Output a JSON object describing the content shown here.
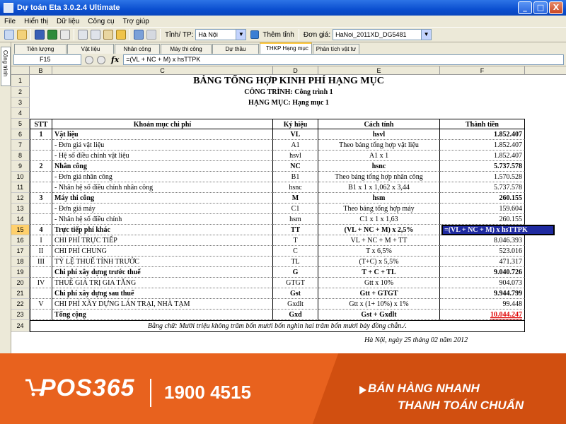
{
  "window": {
    "title": "Dự toán Eta 3.0.2.4 Ultimate",
    "min": "_",
    "max": "□",
    "close": "X"
  },
  "menu": [
    "File",
    "Hiển thị",
    "Dữ liệu",
    "Công cụ",
    "Trợ giúp"
  ],
  "toolbar": {
    "province_label": "Tỉnh/ TP:",
    "province_value": "Hà Nội",
    "add_province": "Thêm tỉnh",
    "price_label": "Đơn giá:",
    "price_value": "HaNoi_2011XD_DG5481"
  },
  "left_tab": "Công trình",
  "tabs": [
    "Tiên lượng",
    "Vật liệu",
    "Nhân công",
    "Máy thi công",
    "Dự thầu",
    "THKP Hạng mục",
    "Phân tích vật tư"
  ],
  "active_tab": "THKP Hạng mục",
  "formula_bar": {
    "cell_ref": "F15",
    "fx": "fx",
    "formula": "=(VL + NC + M) x hsTTPK"
  },
  "columns": [
    "B",
    "C",
    "D",
    "E",
    "F"
  ],
  "sheet": {
    "title": "BẢNG TỔNG HỢP KINH PHÍ HẠNG MỤC",
    "project": "CÔNG TRÌNH: Công trình 1",
    "item": "HẠNG MỤC: Hạng mục 1",
    "headers": [
      "STT",
      "Khoản mục chi phí",
      "Ký hiệu",
      "Cách tính",
      "Thành tiền"
    ],
    "rows": [
      {
        "stt": "1",
        "name": "Vật liệu",
        "code": "VL",
        "method": "hsvl",
        "amount": "1.852.407",
        "bold": true
      },
      {
        "stt": "",
        "name": "- Đơn giá vật liệu",
        "code": "A1",
        "method": "Theo bảng tổng hợp vật liệu",
        "amount": "1.852.407"
      },
      {
        "stt": "",
        "name": "- Hệ số điều chỉnh vật liệu",
        "code": "hsvl",
        "method": "A1 x 1",
        "amount": "1.852.407"
      },
      {
        "stt": "2",
        "name": "Nhân công",
        "code": "NC",
        "method": "hsnc",
        "amount": "5.737.578",
        "bold": true
      },
      {
        "stt": "",
        "name": "- Đơn giá nhân công",
        "code": "B1",
        "method": "Theo bảng tổng hợp nhân công",
        "amount": "1.570.528"
      },
      {
        "stt": "",
        "name": "- Nhân hệ số điều chỉnh nhân công",
        "code": "hsnc",
        "method": "B1 x 1 x 1,062 x 3,44",
        "amount": "5.737.578"
      },
      {
        "stt": "3",
        "name": "Máy thi công",
        "code": "M",
        "method": "hsm",
        "amount": "260.155",
        "bold": true
      },
      {
        "stt": "",
        "name": "- Đơn giá máy",
        "code": "C1",
        "method": "Theo bảng tổng hợp máy",
        "amount": "159.604"
      },
      {
        "stt": "",
        "name": "- Nhân hệ số điều chỉnh",
        "code": "hsm",
        "method": "C1 x 1 x 1,63",
        "amount": "260.155"
      },
      {
        "stt": "4",
        "name": "Trực tiếp phí khác",
        "code": "TT",
        "method": "(VL + NC + M) x 2,5%",
        "amount": "=(VL + NC + M) x hsTTPK",
        "bold": true,
        "selected": true
      },
      {
        "stt": "I",
        "name": "CHI PHÍ TRỰC TIẾP",
        "code": "T",
        "method": "VL + NC + M + TT",
        "amount": "8.046.393"
      },
      {
        "stt": "II",
        "name": "CHI PHÍ CHUNG",
        "code": "C",
        "method": "T x 6,5%",
        "amount": "523.016"
      },
      {
        "stt": "III",
        "name": "TỶ LỆ THUẾ TÍNH TRƯỚC",
        "code": "TL",
        "method": "(T+C) x 5,5%",
        "amount": "471.317"
      },
      {
        "stt": "",
        "name": "Chi phí xây dựng trước thuế",
        "code": "G",
        "method": "T + C + TL",
        "amount": "9.040.726",
        "bold": true
      },
      {
        "stt": "IV",
        "name": "THUẾ GIÁ TRỊ GIA TĂNG",
        "code": "GTGT",
        "method": "Gtt x 10%",
        "amount": "904.073"
      },
      {
        "stt": "",
        "name": "Chi phí xây dựng sau thuế",
        "code": "Gst",
        "method": "Gtt + GTGT",
        "amount": "9.944.799",
        "bold": true
      },
      {
        "stt": "V",
        "name": "CHI PHÍ XÂY DỰNG LÁN TRẠI, NHÀ TẠM",
        "code": "Gxdlt",
        "method": "Gtt x (1+ 10%) x 1%",
        "amount": "99.448"
      },
      {
        "stt": "",
        "name": "Tổng cộng",
        "code": "Gxd",
        "method": "Gst + Gxdlt",
        "amount": "10.044.247",
        "bold": true,
        "total": true
      }
    ],
    "words": "Bằng chữ: Mười triệu không trăm bốn mươi bốn nghìn hai trăm bốn mươi bảy đồng chẵn./.",
    "date": "Hà Nội, ngày 25 tháng 02 năm 2012"
  },
  "banner": {
    "brand": "POS365",
    "phone": "1900 4515",
    "slogan1": "BÁN HÀNG NHANH",
    "slogan2": "THANH TOÁN CHUẨN",
    "bg_color": "#e8621e"
  }
}
